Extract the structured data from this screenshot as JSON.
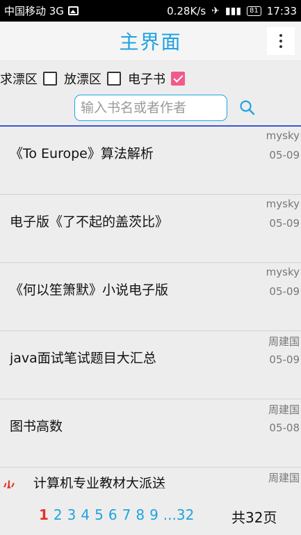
{
  "status_bar": {
    "carrier": "中国移动 3G",
    "speed": "0.28K/s",
    "battery": "81",
    "time": "17:33"
  },
  "header": {
    "title": "主界面"
  },
  "filters": [
    {
      "label": "求漂区",
      "checked": false
    },
    {
      "label": "放漂区",
      "checked": false
    },
    {
      "label": "电子书",
      "checked": true
    }
  ],
  "search": {
    "placeholder": "输入书名或者作者"
  },
  "books": [
    {
      "title": "《To Europe》算法解析",
      "author": "mysky",
      "date": "05-09"
    },
    {
      "title": "电子版《了不起的盖茨比》",
      "author": "mysky",
      "date": "05-09"
    },
    {
      "title": "《何以笙箫默》小说电子版",
      "author": "mysky",
      "date": "05-09"
    },
    {
      "title": "java面试笔试题目大汇总",
      "author": "周建国",
      "date": "05-09"
    },
    {
      "title": "图书高数",
      "author": "周建国",
      "date": "05-08"
    },
    {
      "title": "计算机专业教材大派送",
      "author": "周建国",
      "date": ""
    }
  ],
  "pagination": {
    "pages": [
      "1",
      "2",
      "3",
      "4",
      "5",
      "6",
      "7",
      "8",
      "9",
      "...32"
    ],
    "current": "1",
    "total_label": "共32页"
  },
  "colors": {
    "accent": "#1fa3e1",
    "checkbox_checked": "#f25a8a",
    "current_page": "#e5302a",
    "divider": "#3a55d1"
  }
}
